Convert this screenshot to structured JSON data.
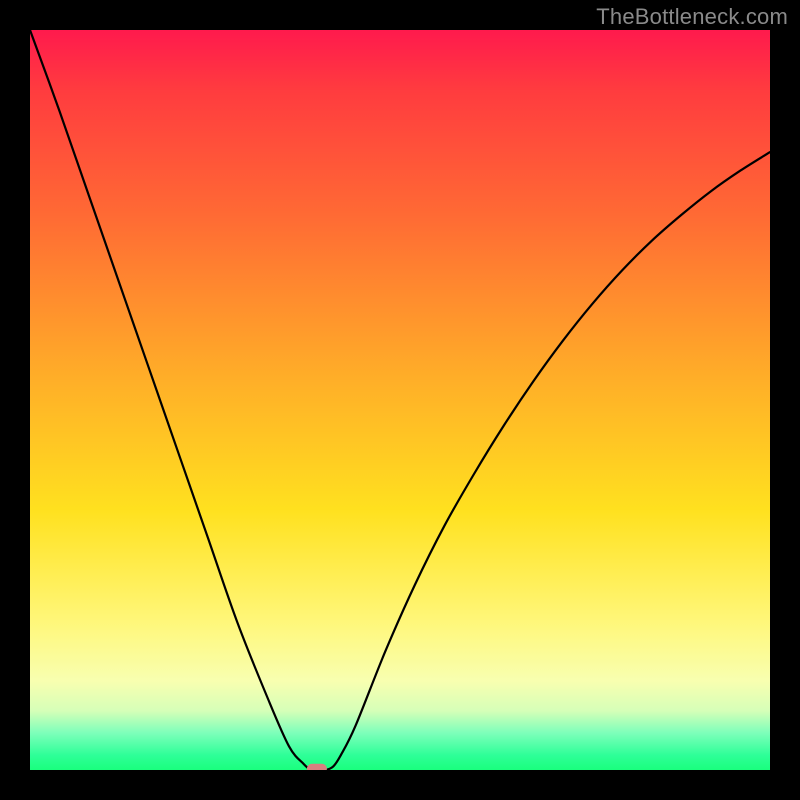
{
  "watermark": "TheBottleneck.com",
  "chart_data": {
    "type": "line",
    "title": "",
    "xlabel": "",
    "ylabel": "",
    "xlim": [
      0,
      100
    ],
    "ylim": [
      0,
      100
    ],
    "x": [
      0,
      4,
      8,
      12,
      16,
      20,
      24,
      28,
      32,
      35,
      37,
      38,
      39,
      40,
      41,
      42,
      44,
      48,
      52,
      56,
      60,
      64,
      68,
      72,
      76,
      80,
      84,
      88,
      92,
      96,
      100
    ],
    "values": [
      100,
      89,
      77.5,
      66,
      54.5,
      43,
      31.5,
      20,
      10,
      3.2,
      0.8,
      0,
      0,
      0,
      0.5,
      2,
      6,
      16,
      25,
      33,
      40,
      46.5,
      52.5,
      58,
      63,
      67.5,
      71.5,
      75,
      78.2,
      81,
      83.5
    ],
    "marker": {
      "x": 38.5,
      "y": 0.3
    },
    "background_gradient": [
      "#ff1a4d",
      "#ff6a34",
      "#ffe11f",
      "#f8ffb0",
      "#1aff7d"
    ]
  }
}
